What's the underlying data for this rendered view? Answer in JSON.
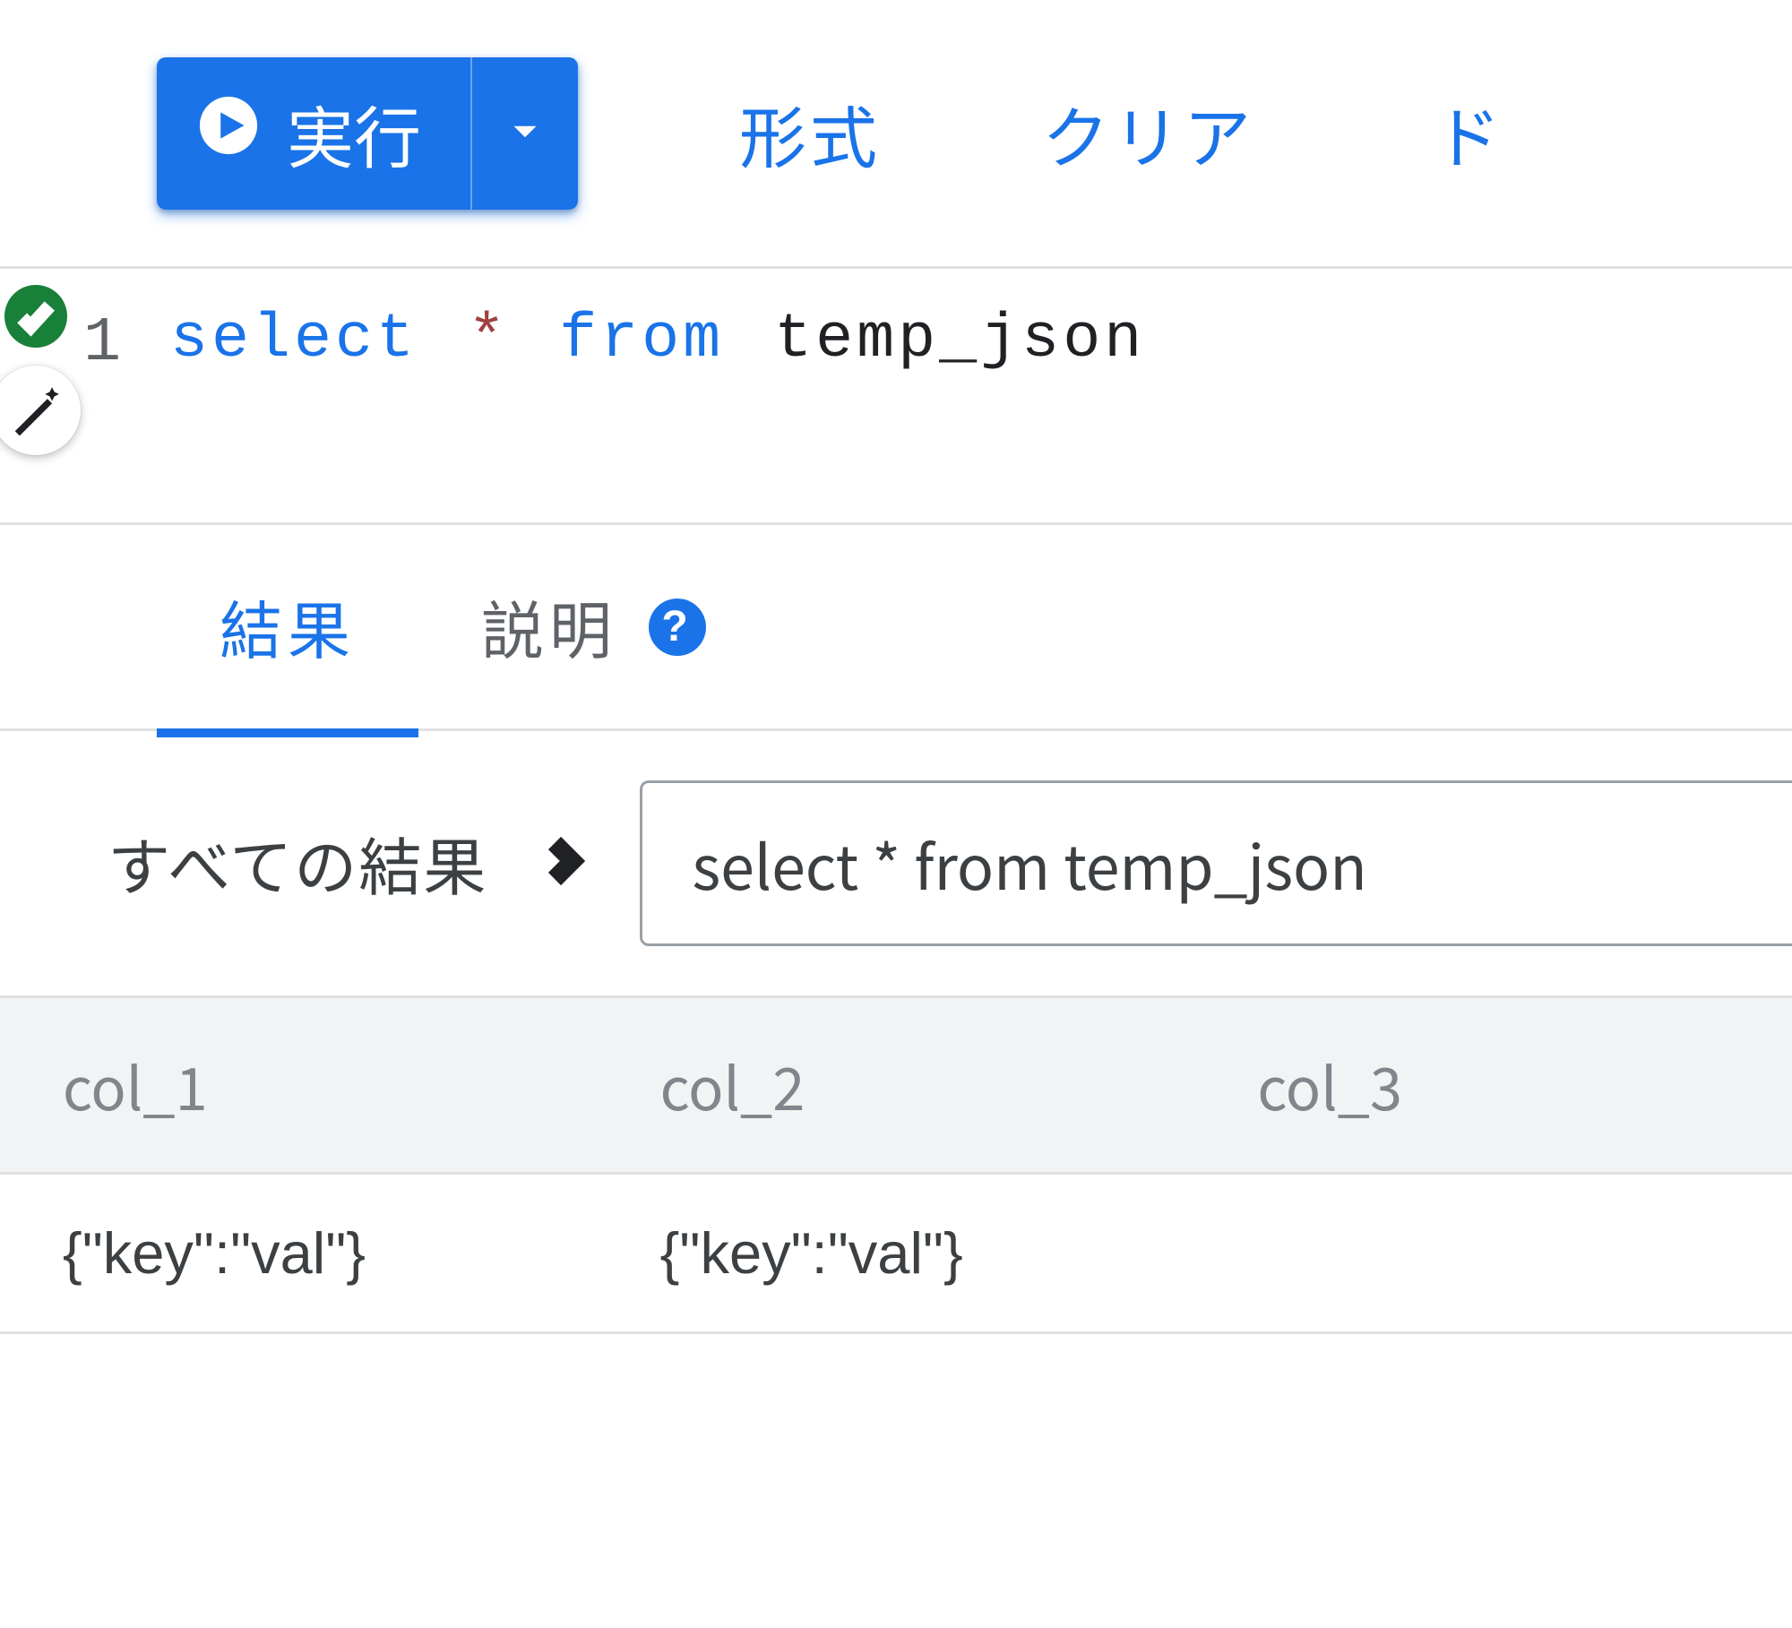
{
  "toolbar": {
    "run_label": "実行",
    "format_label": "形式",
    "clear_label": "クリア",
    "extra_cut_label": "ド"
  },
  "editor": {
    "line_number": "1",
    "tokens": {
      "select": "select",
      "star": "*",
      "from": "from",
      "table": "temp_json"
    }
  },
  "tabs": {
    "results": "結果",
    "explain": "説明",
    "help_glyph": "?"
  },
  "breadcrumb": {
    "all_results": "すべての結果",
    "query_text": "select * from temp_json"
  },
  "table": {
    "columns": [
      "col_1",
      "col_2",
      "col_3"
    ],
    "rows": [
      [
        "{\"key\":\"val\"}",
        "{\"key\":\"val\"}",
        ""
      ]
    ]
  }
}
